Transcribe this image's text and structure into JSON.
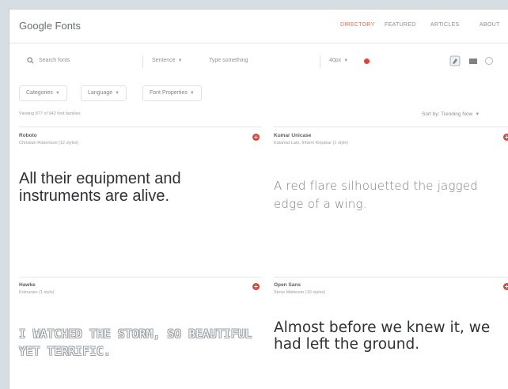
{
  "header": {
    "logo": "Google Fonts",
    "nav": [
      "DIRECTORY",
      "FEATURED",
      "ARTICLES",
      "ABOUT"
    ]
  },
  "search": {
    "placeholder": "Search fonts",
    "sample_mode": "Sentence",
    "sample_placeholder": "Type something",
    "size": "40px"
  },
  "filters": {
    "chips": [
      "Categories",
      "Language",
      "Font Properties"
    ],
    "results_text": "Viewing 877 of 943 font families",
    "sort_text": "Sort by: Trending Now"
  },
  "cards": [
    {
      "name": "Roboto",
      "meta": "Christian Robertson (12 styles)",
      "sample": "All their equipment and instruments are alive."
    },
    {
      "name": "Kumar Unicase",
      "meta": "Kalamat Lam, Infarm Kirpakar (1 style)",
      "sample": "A red flare silhouetted the jagged edge of a wing."
    },
    {
      "name": "Hawke",
      "meta": "Kotnarain (1 style)",
      "sample": "I WATCHED THE STORM, SO BEAUTIFUL YET TERRIFIC."
    },
    {
      "name": "Open Sans",
      "meta": "Steve Matteson (10 styles)",
      "sample": "Almost before we knew it, we had left the ground."
    }
  ],
  "colors": {
    "accent": "#e2413a",
    "nav_active": "#e8704f"
  }
}
